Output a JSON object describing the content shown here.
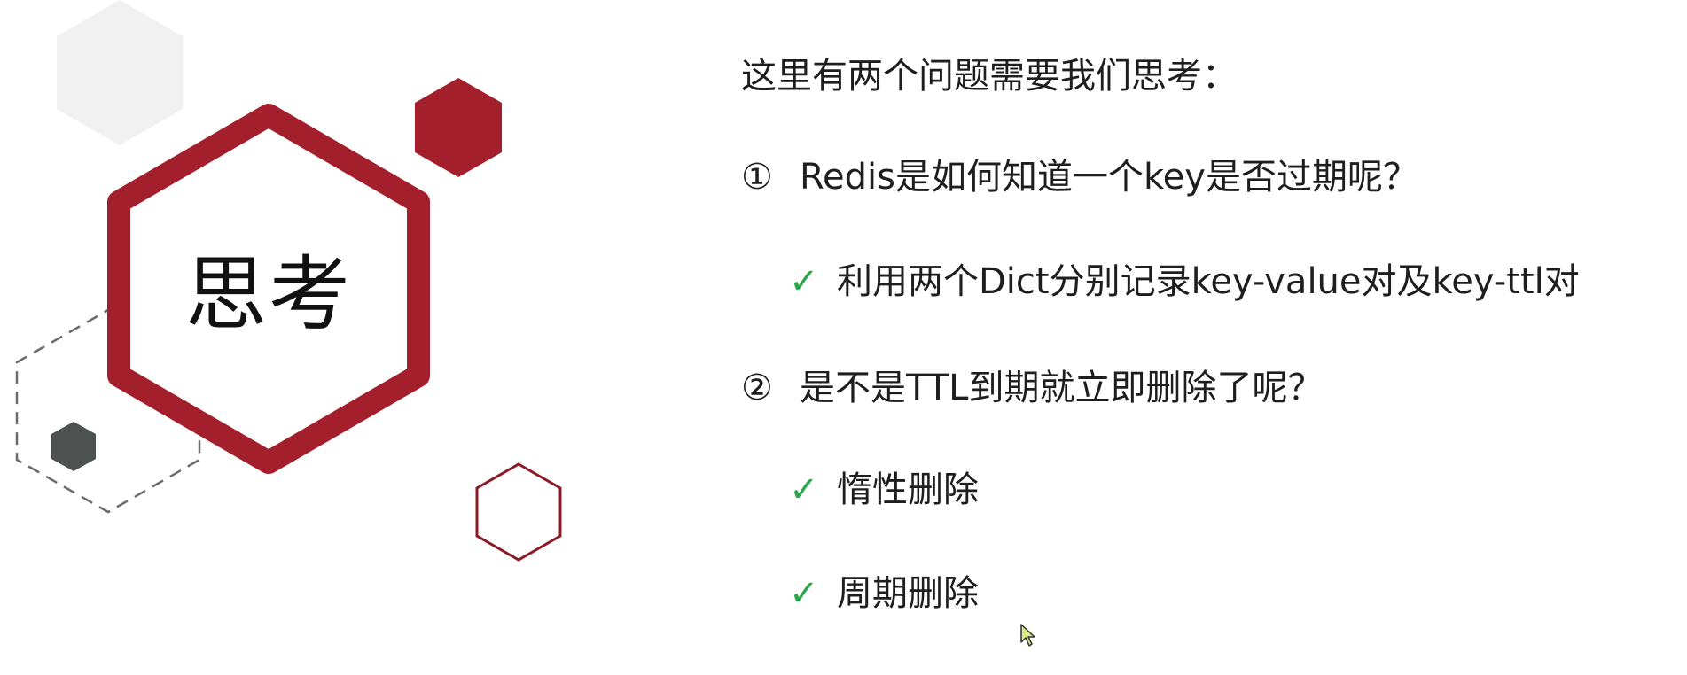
{
  "slide": {
    "title_word": "思考",
    "intro": "这里有两个问题需要我们思考：",
    "questions": [
      {
        "number": "①",
        "text": "Redis是如何知道一个key是否过期呢？",
        "answers": [
          "利用两个Dict分别记录key-value对及key-ttl对"
        ]
      },
      {
        "number": "②",
        "text": "是不是TTL到期就立即删除了呢？",
        "answers": [
          "惰性删除",
          "周期删除"
        ]
      }
    ],
    "check_mark": "✓"
  },
  "colors": {
    "accent_red": "#a31f2b",
    "check_green": "#2aa84a",
    "dark_gray": "#4d5250",
    "light_gray": "#f1f1f1"
  },
  "icons": {
    "check": "check-icon",
    "cursor": "mouse-cursor-icon"
  }
}
